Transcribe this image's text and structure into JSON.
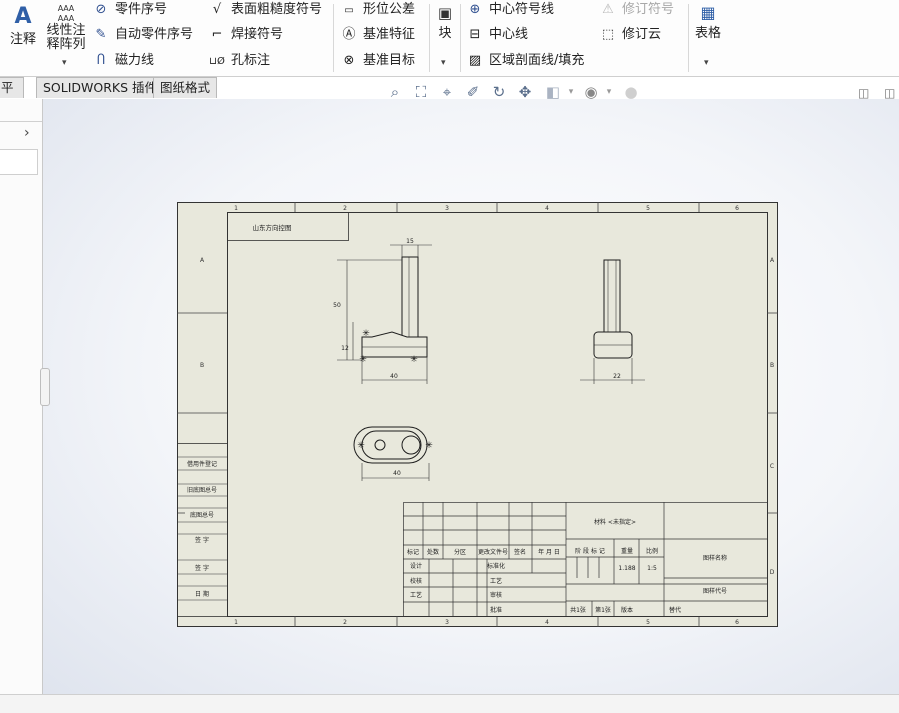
{
  "ribbon": {
    "annotation": "注释",
    "linear_pattern_line1": "线性注",
    "linear_pattern_line2": "释阵列",
    "balloon": "零件序号",
    "auto_balloon": "自动零件序号",
    "magnetic_line": "磁力线",
    "surface_finish": "表面粗糙度符号",
    "weld_symbol": "焊接符号",
    "hole_callout": "孔标注",
    "geometric_tolerance": "形位公差",
    "datum_feature": "基准特征",
    "datum_target": "基准目标",
    "block": "块",
    "center_mark": "中心符号线",
    "centerline": "中心线",
    "area_hatch": "区域剖面线/填充",
    "revision_symbol": "修订符号",
    "revision_cloud": "修订云",
    "table": "表格"
  },
  "tabs": [
    "平估",
    "SOLIDWORKS 插件",
    "图纸格式"
  ],
  "drawing": {
    "header_note": "山东方向控图",
    "dim_top_width": "15",
    "dim_height_total": "50",
    "dim_base_height": "12",
    "dim_front_length": "40",
    "dim_side_width": "22",
    "dim_bottom_length": "40",
    "zone_cols": [
      "1",
      "2",
      "3",
      "4",
      "5",
      "6"
    ],
    "zone_rows": [
      "A",
      "B",
      "C",
      "D"
    ],
    "left_strip_labels": [
      "借用件登记",
      "旧底图总号",
      "底图总号",
      "签 字",
      "签 字",
      "日 期"
    ],
    "title_block": {
      "title_note": "材料 <未指定>",
      "stage_mark": "阶 段 标 记",
      "weight": "重量",
      "scale": "比例",
      "weight_value": "1.188",
      "scale_value": "1:5",
      "drawing_name": "图样名称",
      "drawing_code": "图样代号",
      "rev_mark": "标记",
      "rev_count": "处数",
      "rev_zone": "分区",
      "rev_doc": "更改文件号",
      "rev_sign": "签名",
      "rev_date": "年 月 日",
      "designer": "设计",
      "checker": "校核",
      "std_check": "标准化",
      "process": "工艺",
      "audit": "审核",
      "approve": "批准",
      "total_sheets": "共1张",
      "sheet_no": "第1张",
      "version": "版本",
      "replace": "替代"
    }
  }
}
